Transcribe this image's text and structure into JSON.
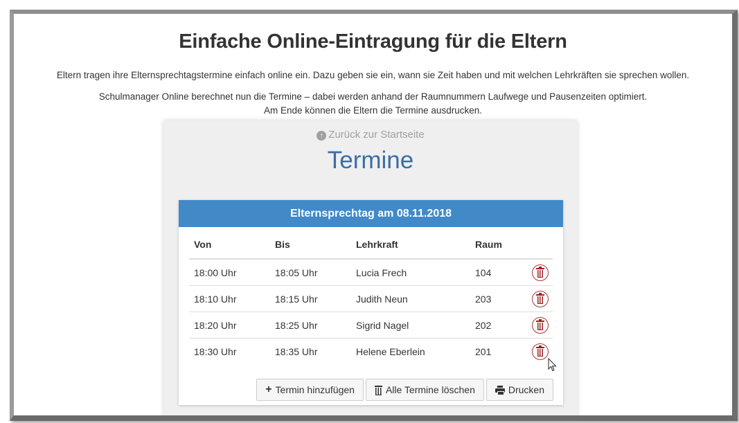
{
  "headline": "Einfache Online-Eintragung für die Eltern",
  "intro": {
    "line1": "Eltern tragen ihre Elternsprechtagstermine einfach online ein. Dazu geben sie ein, wann sie Zeit haben und mit welchen Lehrkräften sie sprechen wollen.",
    "line2": "Schulmanager Online berechnet nun die Termine – dabei werden anhand der Raumnummern Laufwege und Pausenzeiten optimiert.",
    "line3": "Am Ende können die Eltern die Termine ausdrucken."
  },
  "panel": {
    "back_link": "Zurück zur Startseite",
    "title": "Termine"
  },
  "card": {
    "header": "Elternsprechtag am 08.11.2018",
    "columns": {
      "von": "Von",
      "bis": "Bis",
      "lehrkraft": "Lehrkraft",
      "raum": "Raum"
    },
    "rows": [
      {
        "von": "18:00 Uhr",
        "bis": "18:05 Uhr",
        "lehrkraft": "Lucia Frech",
        "raum": "104"
      },
      {
        "von": "18:10 Uhr",
        "bis": "18:15 Uhr",
        "lehrkraft": "Judith Neun",
        "raum": "203"
      },
      {
        "von": "18:20 Uhr",
        "bis": "18:25 Uhr",
        "lehrkraft": "Sigrid Nagel",
        "raum": "202"
      },
      {
        "von": "18:30 Uhr",
        "bis": "18:35 Uhr",
        "lehrkraft": "Helene Eberlein",
        "raum": "201"
      }
    ],
    "buttons": {
      "add": "Termin hinzufügen",
      "delete_all": "Alle Termine löschen",
      "print": "Drucken"
    }
  },
  "colors": {
    "accent_blue": "#4189c7",
    "title_blue": "#3a6ea5",
    "delete_red": "#9a2020"
  },
  "icons": {
    "back": "circle-arrow-up-icon",
    "delete": "trash-icon",
    "add": "plus-icon",
    "print": "printer-icon"
  }
}
